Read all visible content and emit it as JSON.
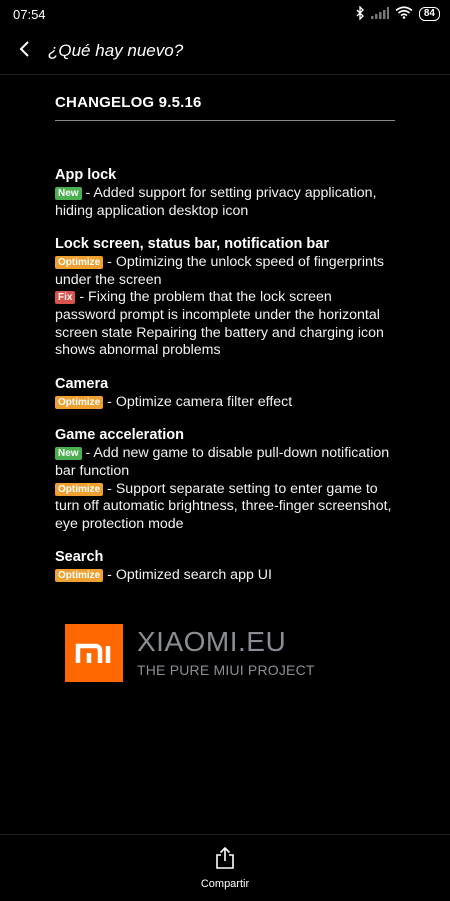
{
  "status_bar": {
    "time": "07:54",
    "battery": "84"
  },
  "app_bar": {
    "title": "¿Qué hay nuevo?"
  },
  "changelog": {
    "title": "CHANGELOG 9.5.16",
    "sections": [
      {
        "title": "App lock",
        "entries": [
          {
            "badge": "New",
            "text": " - Added support for setting privacy application, hiding application desktop icon"
          }
        ]
      },
      {
        "title": "Lock screen, status bar, notification bar",
        "entries": [
          {
            "badge": "Optimize",
            "text": " - Optimizing the unlock speed of fingerprints under the screen"
          },
          {
            "badge": "Fix",
            "text": " - Fixing the problem that the lock screen password prompt is incomplete under the horizontal screen state Repairing the battery and charging icon shows abnormal problems"
          }
        ]
      },
      {
        "title": "Camera",
        "entries": [
          {
            "badge": "Optimize",
            "text": " - Optimize camera filter effect"
          }
        ]
      },
      {
        "title": "Game acceleration",
        "entries": [
          {
            "badge": "New",
            "text": " - Add new game to disable pull-down notification bar function"
          },
          {
            "badge": "Optimize",
            "text": " - Support separate setting to enter game to turn off automatic brightness, three-finger screenshot, eye protection mode"
          }
        ]
      },
      {
        "title": "Search",
        "entries": [
          {
            "badge": "Optimize",
            "text": " - Optimized search app UI"
          }
        ]
      }
    ]
  },
  "logo": {
    "name": "XIAOMI.EU",
    "tagline": "THE PURE MIUI PROJECT",
    "brand_color": "#ff6700"
  },
  "bottom_bar": {
    "share_label": "Compartir",
    "share_icon": "share-icon"
  },
  "colors": {
    "new": "#4caf50",
    "optimize": "#f0a030",
    "fix": "#d9534f"
  }
}
